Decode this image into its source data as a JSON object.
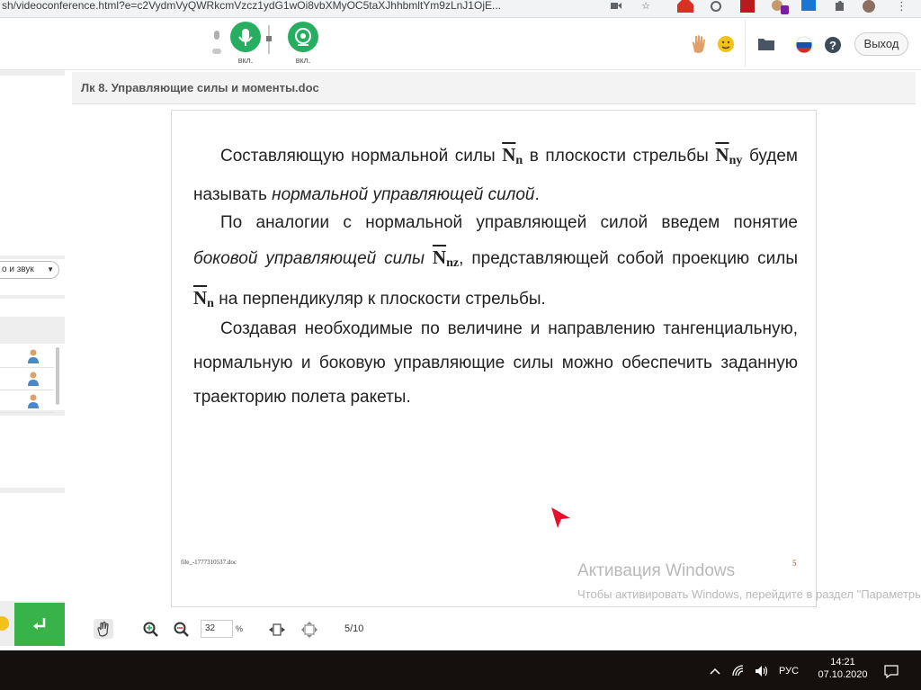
{
  "browser": {
    "url": "sh/videoconference.html?e=c2VydmVyQWRkcmVzcz1ydG1wOi8vbXMyOC5taXJhhbmltYm9zLnJ1OjE..."
  },
  "toolbar": {
    "mic_label": "вкл.",
    "camera_label": "вкл.",
    "exit_label": "Выход"
  },
  "left_panel": {
    "audio_select": "о и звук"
  },
  "document": {
    "title": "Лк 8. Управляющие силы и моменты.doc",
    "p1_a": "Составляющую нормальной силы",
    "p1_sym1": "N",
    "p1_sub1": "n",
    "p1_b": "в плоскости стрельбы",
    "p1_sym2": "N",
    "p1_sub2": "ny",
    "p1_c": "будем называть",
    "p1_em": "нормальной управляющей силой",
    "p1_end": ".",
    "p2_a": "По аналогии с нормальной управляющей силой введем понятие",
    "p2_em": "боковой управляющей силы",
    "p2_sym": "N",
    "p2_sub": "nz",
    "p2_b": ", представляющей собой проекцию силы",
    "p2_sym2": "N",
    "p2_sub2": "n",
    "p2_c": "на перпендикуляр к плоскости стрельбы.",
    "p3": "Создавая необходимые по величине и направлению тангенциальную, нормальную и боковую управляющие силы можно обеспечить заданную траекторию полета ракеты.",
    "footer_file": "file_-1777310537.doc",
    "page_number": "5"
  },
  "doc_toolbar": {
    "zoom_value": "32",
    "zoom_unit": "%",
    "page_counter": "5/10"
  },
  "watermark": {
    "title": "Активация Windows",
    "text": "Чтобы активировать Windows, перейдите в раздел \"Параметры\"."
  },
  "taskbar": {
    "lang": "РУС",
    "time": "14:21",
    "date": "07.10.2020"
  },
  "colors": {
    "accent_green": "#27ae60",
    "go_button": "#37b34a",
    "pointer_red": "#e8102a",
    "taskbar": "#15100e"
  }
}
